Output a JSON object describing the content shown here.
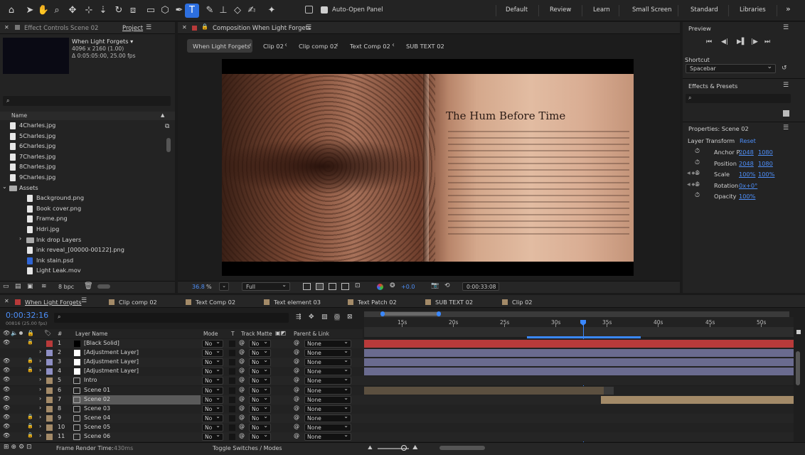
{
  "colors": {
    "accent": "#2d6fe0",
    "link": "#4d8ef7",
    "timecode": "#4d8ef7",
    "red_label": "#b83a3a",
    "lavender": "#8e8fc4",
    "tan": "#a38a68",
    "playhead": "#3a88ff"
  },
  "toolbar": {
    "tools": [
      "home-icon",
      "select-arrow-icon",
      "hand-icon",
      "zoom-icon",
      "orbit-icon",
      "pan-behind-icon",
      "move-down-icon",
      "rotate-icon",
      "camera-icon",
      "rectangle-icon",
      "cube-icon",
      "pen-icon",
      "type-icon",
      "brush-icon",
      "clone-stamp-icon",
      "eraser-icon",
      "roto-brush-icon",
      "puppet-pin-icon"
    ],
    "auto_open": "Auto-Open Panel",
    "workspaces": [
      "Default",
      "Review",
      "Learn",
      "Small Screen",
      "Standard",
      "Libraries"
    ],
    "more": "»"
  },
  "project": {
    "tab_effect": "Effect Controls Scene 02",
    "tab_project": "Project",
    "comp_name": "When Light Forgets ▾",
    "comp_size": "4096 x 2160 (1.00)",
    "comp_dur": "Δ 0:05:05:00, 25.00 fps",
    "search_placeholder": "",
    "col_name": "Name",
    "bpc": "8 bpc",
    "items": [
      {
        "t": "file",
        "n": "4Charles.jpg",
        "i": 0
      },
      {
        "t": "file",
        "n": "5Charles.jpg",
        "i": 0
      },
      {
        "t": "file",
        "n": "6Charles.jpg",
        "i": 0
      },
      {
        "t": "file",
        "n": "7Charles.jpg",
        "i": 0
      },
      {
        "t": "file",
        "n": "8Charles.jpg",
        "i": 0
      },
      {
        "t": "file",
        "n": "9Charles.jpg",
        "i": 0
      },
      {
        "t": "folder",
        "n": "Assets",
        "i": 0
      },
      {
        "t": "file",
        "n": "Background.png",
        "i": 1
      },
      {
        "t": "file",
        "n": "Book cover.png",
        "i": 1
      },
      {
        "t": "file",
        "n": "Frame.png",
        "i": 1
      },
      {
        "t": "file",
        "n": "Hdri.jpg",
        "i": 1
      },
      {
        "t": "folder",
        "n": "Ink drop Layers",
        "i": 1
      },
      {
        "t": "file",
        "n": "ink reveal_[00000-00122].png",
        "i": 1
      },
      {
        "t": "psd",
        "n": "Ink stain.psd",
        "i": 1
      },
      {
        "t": "file",
        "n": "Light Leak.mov",
        "i": 1
      }
    ]
  },
  "comp": {
    "tab": "Composition When Light Forgets",
    "breadcrumbs": [
      "When Light Forgets",
      "Clip 02",
      "Clip comp 02",
      "Text Comp 02",
      "SUB TEXT 02"
    ],
    "image_title": "The Hum Before Time",
    "zoom": "36.8",
    "pct": "%",
    "quality": "Full",
    "exposure": "+0.0",
    "timecode": "0:00:33:08"
  },
  "right": {
    "preview_title": "Preview",
    "shortcut_label": "Shortcut",
    "shortcut_value": "Spacebar",
    "effects_title": "Effects & Presets",
    "props_title": "Properties: Scene 02",
    "layer_transform": "Layer Transform",
    "reset": "Reset",
    "props": [
      {
        "name": "Anchor P...",
        "v1": "2048",
        "v2": "1080"
      },
      {
        "name": "Position",
        "v1": "2048",
        "v2": "1080"
      },
      {
        "name": "Scale",
        "v1": "100%",
        "v2": "100%"
      },
      {
        "name": "Rotation",
        "v1": "0x+0°",
        "v2": ""
      },
      {
        "name": "Opacity",
        "v1": "100%",
        "v2": ""
      }
    ]
  },
  "timeline": {
    "tabs": [
      "When Light Forgets",
      "Clip comp 02",
      "Text Comp 02",
      "Text element 03",
      "Text Patch 02",
      "SUB TEXT 02",
      "Clip 02"
    ],
    "timecode": "0:00:32:16",
    "frames": "00816 (25.00 fps)",
    "col_layer": "Layer Name",
    "col_mode": "Mode",
    "col_t": "T",
    "col_matte": "Track Matte",
    "col_parent": "Parent & Link",
    "ruler": [
      "15s",
      "20s",
      "25s",
      "30s",
      "35s",
      "40s",
      "45s",
      "50s"
    ],
    "render_time_label": "Frame Render Time:",
    "render_time": "430ms",
    "toggle": "Toggle Switches / Modes",
    "layers": [
      {
        "n": "1",
        "name": "[Black Solid]",
        "color": "#b83a3a",
        "mode": "No",
        "parent": "None"
      },
      {
        "n": "2",
        "name": "[Adjustment Layer]",
        "color": "#8e8fc4",
        "mode": "No",
        "parent": "None"
      },
      {
        "n": "3",
        "name": "[Adjustment Layer]",
        "color": "#8e8fc4",
        "mode": "No",
        "parent": "None"
      },
      {
        "n": "4",
        "name": "[Adjustment Layer]",
        "color": "#8e8fc4",
        "mode": "No",
        "parent": "None"
      },
      {
        "n": "5",
        "name": "Intro",
        "color": "#a38a68",
        "mode": "No",
        "parent": "None"
      },
      {
        "n": "6",
        "name": "Scene 01",
        "color": "#a38a68",
        "mode": "No",
        "parent": "None"
      },
      {
        "n": "7",
        "name": "Scene 02",
        "color": "#a38a68",
        "mode": "No",
        "parent": "None"
      },
      {
        "n": "8",
        "name": "Scene 03",
        "color": "#a38a68",
        "mode": "No",
        "parent": "None"
      },
      {
        "n": "9",
        "name": "Scene 04",
        "color": "#a38a68",
        "mode": "No",
        "parent": "None"
      },
      {
        "n": "10",
        "name": "Scene 05",
        "color": "#a38a68",
        "mode": "No",
        "parent": "None"
      },
      {
        "n": "11",
        "name": "Scene 06",
        "color": "#a38a68",
        "mode": "No",
        "parent": "None"
      }
    ]
  }
}
